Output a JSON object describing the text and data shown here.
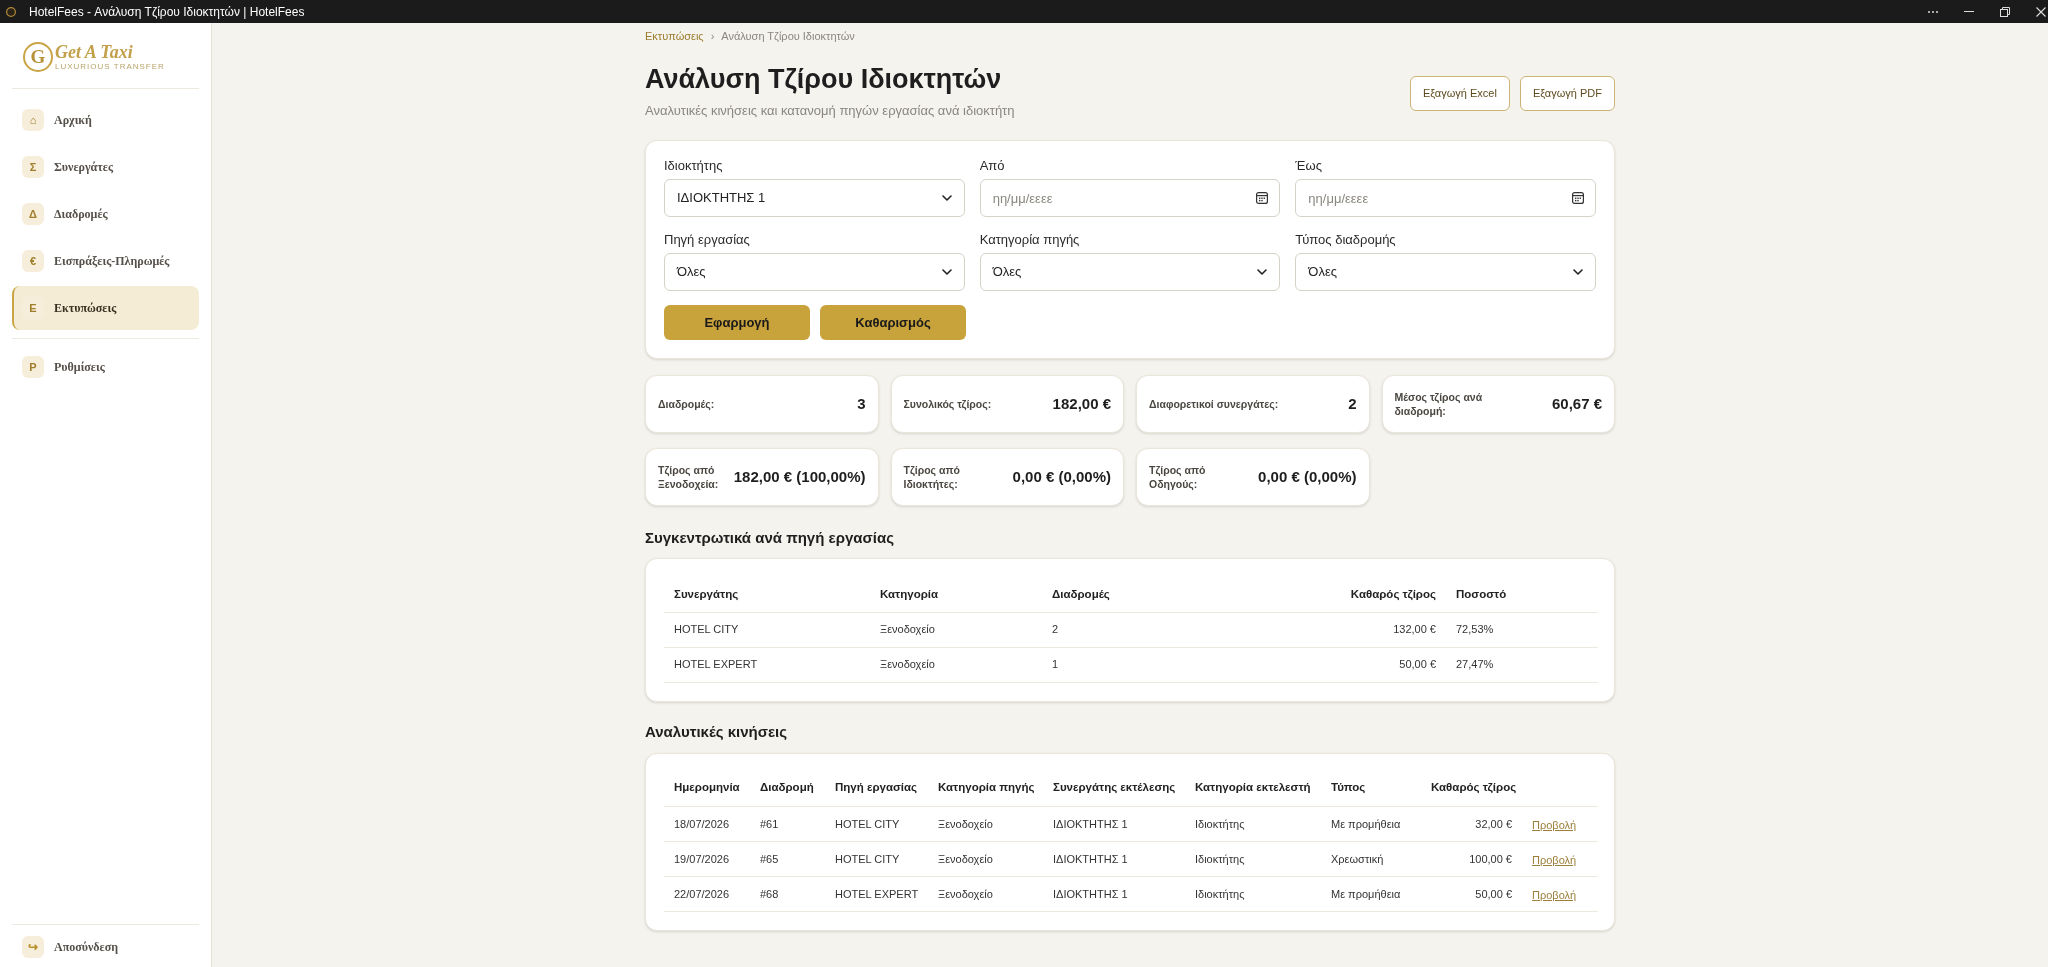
{
  "window": {
    "title": "HotelFees - Ανάλυση Τζίρου Ιδιοκτητών | HotelFees"
  },
  "sidebar": {
    "logo": {
      "mark": "G",
      "name": "Get A Taxi",
      "tagline": "LUXURIOUS TRANSFER"
    },
    "menu": [
      {
        "icon": "⌂",
        "label": "Αρχική",
        "selected": false
      },
      {
        "icon": "Σ",
        "label": "Συνεργάτες",
        "selected": false
      },
      {
        "icon": "Δ",
        "label": "Διαδρομές",
        "selected": false
      },
      {
        "icon": "€",
        "label": "Εισπράξεις-Πληρωμές",
        "selected": false
      },
      {
        "icon": "Ε",
        "label": "Εκτυπώσεις",
        "selected": true
      }
    ],
    "settings_menu": [
      {
        "icon": "Ρ",
        "label": "Ρυθμίσεις",
        "selected": false
      }
    ],
    "logout": {
      "icon": "↪",
      "label": "Αποσύνδεση"
    }
  },
  "breadcrumbs": {
    "separator": "›",
    "items": [
      {
        "kind": "link",
        "label": "Εκτυπώσεις"
      },
      {
        "kind": "current",
        "label": "Ανάλυση Τζίρου Ιδιοκτητών"
      }
    ]
  },
  "header": {
    "title": "Ανάλυση Τζίρου Ιδιοκτητών",
    "subtitle": "Αναλυτικές κινήσεις και κατανομή πηγών εργασίας ανά ιδιοκτήτη",
    "actions": [
      "Εξαγωγή Excel",
      "Εξαγωγή PDF"
    ]
  },
  "filters": {
    "fields": [
      {
        "kind": "select",
        "label": "Ιδιοκτήτης",
        "value": "ΙΔΙΟΚΤΗΤΗΣ 1"
      },
      {
        "kind": "date",
        "label": "Από",
        "placeholder": "ηη/μμ/εεεε"
      },
      {
        "kind": "date",
        "label": "Έως",
        "placeholder": "ηη/μμ/εεεε"
      },
      {
        "kind": "select",
        "label": "Πηγή εργασίας",
        "value": "Όλες"
      },
      {
        "kind": "select",
        "label": "Κατηγορία πηγής",
        "value": "Όλες"
      },
      {
        "kind": "select",
        "label": "Τύπος διαδρομής",
        "value": "Όλες"
      }
    ],
    "buttons": [
      "Εφαρμογή",
      "Καθαρισμός"
    ]
  },
  "stats": [
    {
      "label": "Διαδρομές:",
      "value": "3"
    },
    {
      "label": "Συνολικός τζίρος:",
      "value": "182,00 €"
    },
    {
      "label": "Διαφορετικοί συνεργάτες:",
      "value": "2"
    },
    {
      "label": "Μέσος τζίρος ανά διαδρομή:",
      "value": "60,67 €"
    },
    {
      "label": "Τζίρος από Ξενοδοχεία:",
      "value": "182,00 € (100,00%)"
    },
    {
      "label": "Τζίρος από Ιδιοκτήτες:",
      "value": "0,00 € (0,00%)"
    },
    {
      "label": "Τζίρος από Οδηγούς:",
      "value": "0,00 € (0,00%)"
    }
  ],
  "summary": {
    "title": "Συγκεντρωτικά ανά πηγή εργασίας",
    "columns": [
      "Συνεργάτης",
      "Κατηγορία",
      "Διαδρομές",
      "Καθαρός τζίρος",
      "Ποσοστό"
    ],
    "rows": [
      [
        "HOTEL CITY",
        "Ξενοδοχείο",
        "2",
        "132,00 €",
        "72,53%"
      ],
      [
        "HOTEL EXPERT",
        "Ξενοδοχείο",
        "1",
        "50,00 €",
        "27,47%"
      ]
    ]
  },
  "movements": {
    "title": "Αναλυτικές κινήσεις",
    "columns": [
      "Ημερομηνία",
      "Διαδρομή",
      "Πηγή εργασίας",
      "Κατηγορία πηγής",
      "Συνεργάτης εκτέλεσης",
      "Κατηγορία εκτελεστή",
      "Τύπος",
      "Καθαρός τζίρος"
    ],
    "rows": [
      {
        "cells": [
          "18/07/2026",
          "#61",
          "HOTEL CITY",
          "Ξενοδοχείο",
          "ΙΔΙΟΚΤΗΤΗΣ 1",
          "Ιδιοκτήτης",
          "Με προμήθεια",
          "32,00 €"
        ],
        "action": "Προβολή"
      },
      {
        "cells": [
          "19/07/2026",
          "#65",
          "HOTEL CITY",
          "Ξενοδοχείο",
          "ΙΔΙΟΚΤΗΤΗΣ 1",
          "Ιδιοκτήτης",
          "Χρεωστική",
          "100,00 €"
        ],
        "action": "Προβολή"
      },
      {
        "cells": [
          "22/07/2026",
          "#68",
          "HOTEL EXPERT",
          "Ξενοδοχείο",
          "ΙΔΙΟΚΤΗΤΗΣ 1",
          "Ιδιοκτήτης",
          "Με προμήθεια",
          "50,00 €"
        ],
        "action": "Προβολή"
      }
    ]
  }
}
